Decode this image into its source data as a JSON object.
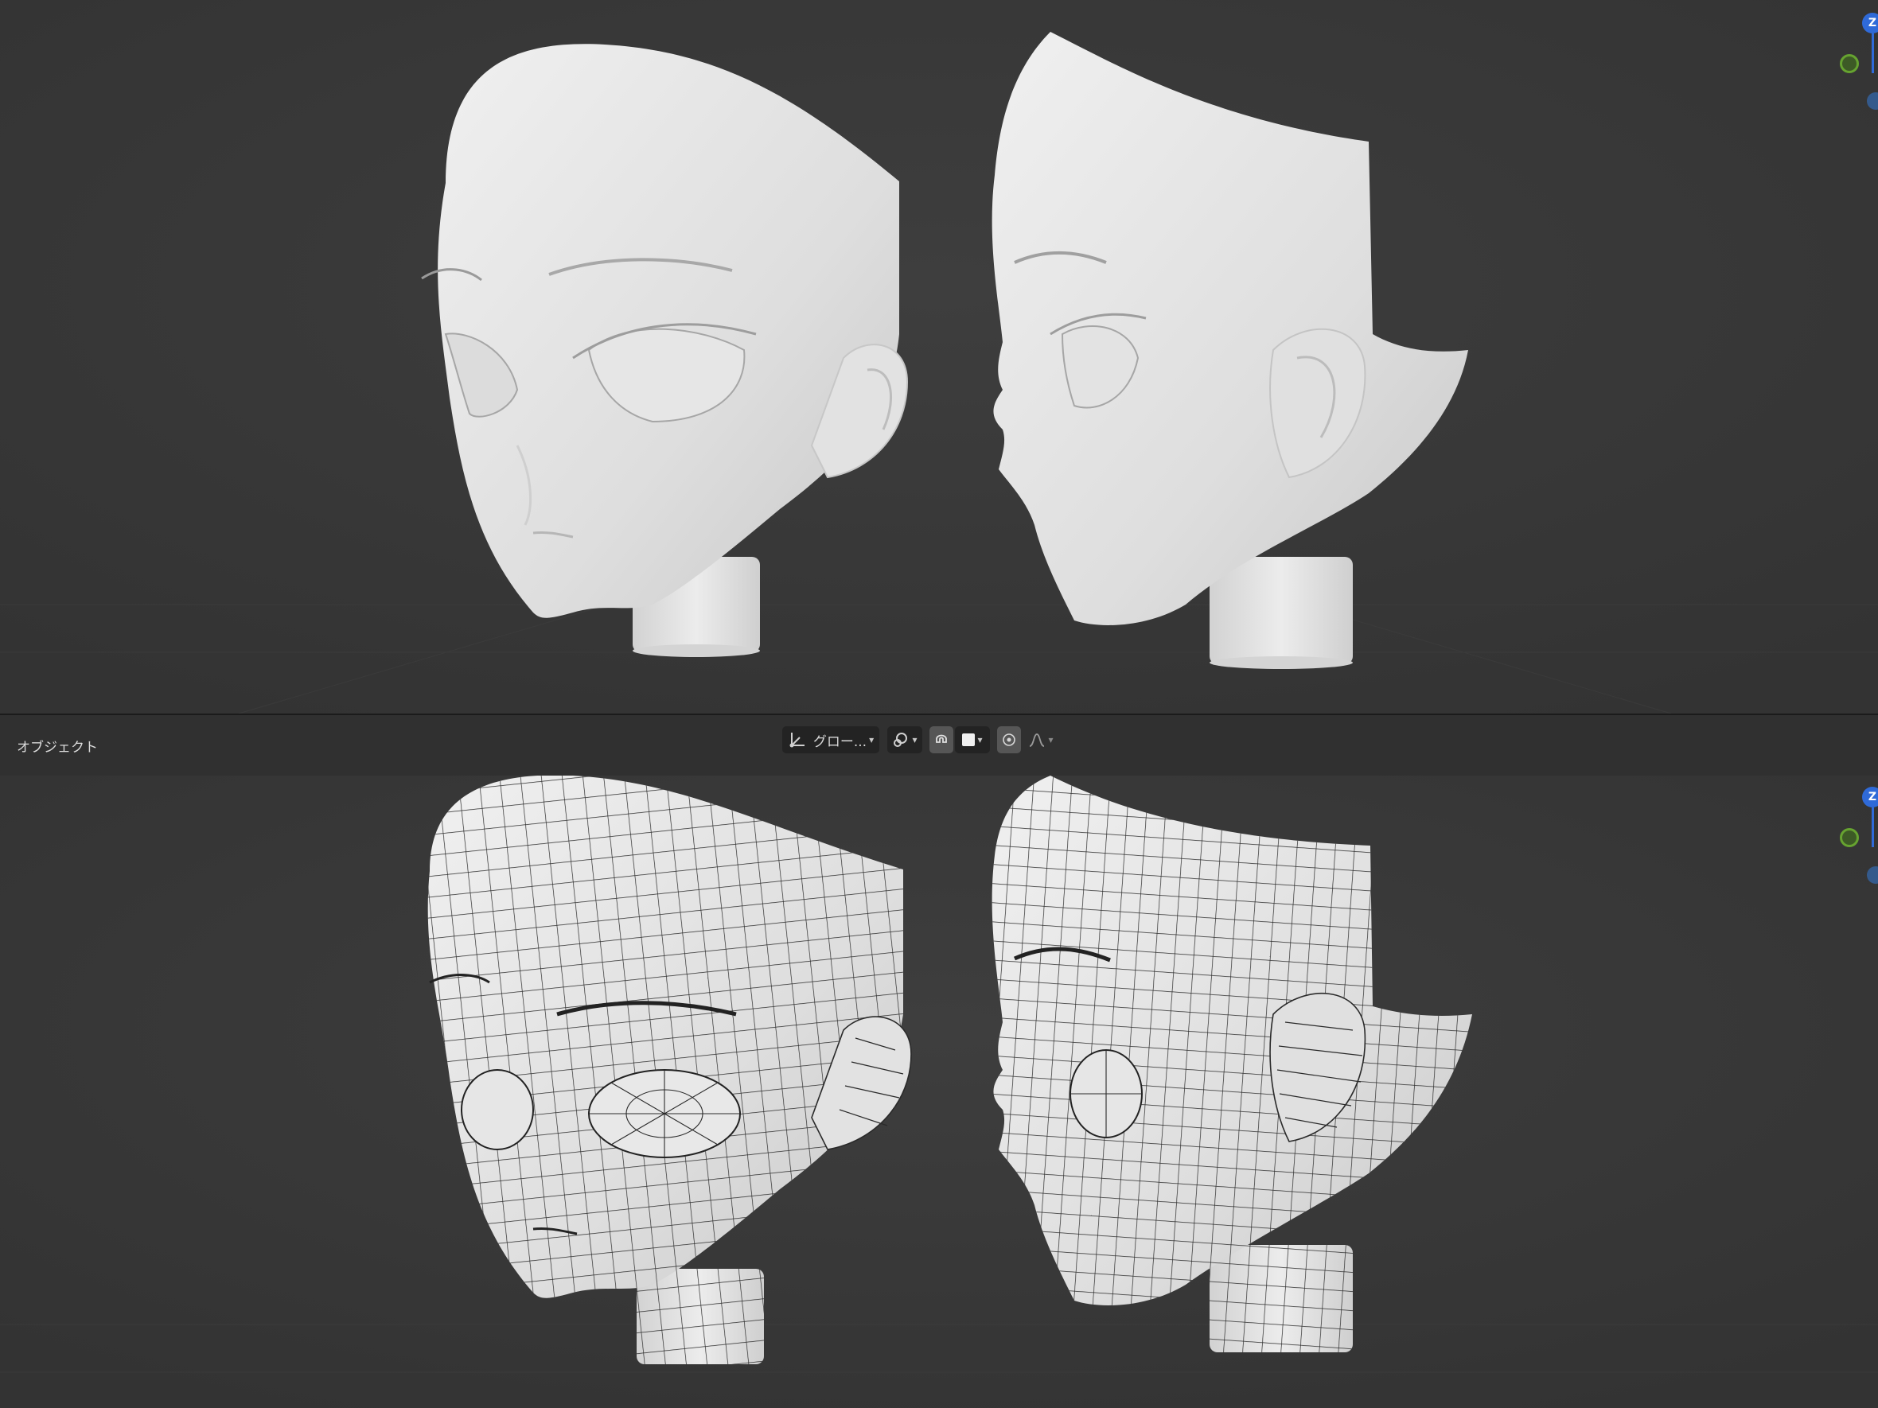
{
  "header": {
    "mode_label": "オブジェクト",
    "transform_orientation": "グロー...",
    "toolbar_icons": [
      "transform-axes-icon",
      "link-pivot-icon",
      "snap-icon",
      "color-swatch-icon",
      "proportional-edit-icon",
      "falloff-curve-icon"
    ],
    "swatch_color": "#f0f0f0"
  },
  "viewports": {
    "top": {
      "shading": "solid",
      "model": "anime-head"
    },
    "bottom": {
      "shading": "solid-wireframe",
      "model": "anime-head"
    }
  },
  "gizmo": {
    "z_label": "Z"
  },
  "colors": {
    "background": "#393939",
    "header": "#303030",
    "model_light": "#e6e6e6",
    "wire": "#262626",
    "axis_z": "#2f6ad8",
    "axis_y": "#66a330"
  }
}
